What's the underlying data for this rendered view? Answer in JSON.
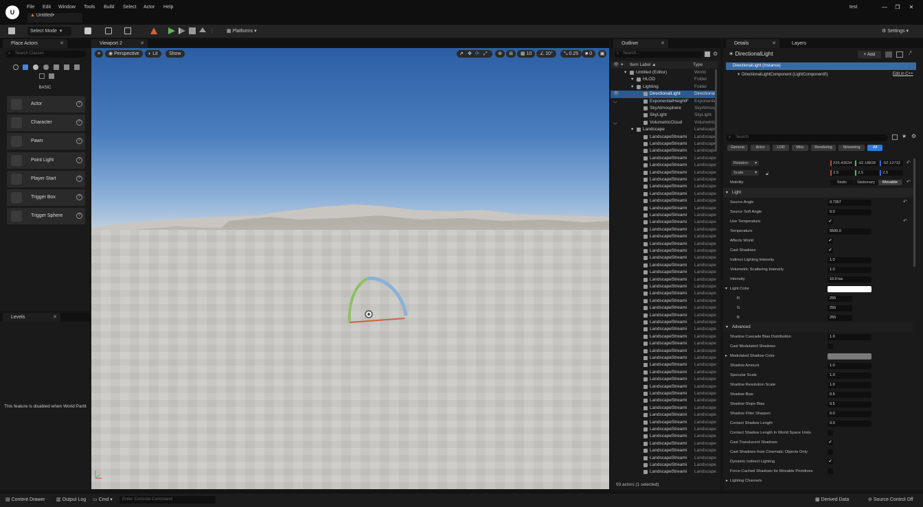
{
  "menu": [
    "File",
    "Edit",
    "Window",
    "Tools",
    "Build",
    "Select",
    "Actor",
    "Help"
  ],
  "app_tab": "Untitled•",
  "project": "test",
  "window_controls": [
    "—",
    "❐",
    "✕"
  ],
  "toolbar": {
    "select_mode": "Select Mode",
    "platforms": "Platforms",
    "settings": "Settings"
  },
  "place_actors": {
    "tab": "Place Actors",
    "search_placeholder": "Search Classes",
    "section": "BASIC",
    "items": [
      "Actor",
      "Character",
      "Pawn",
      "Point Light",
      "Player Start",
      "Trigger Box",
      "Trigger Sphere"
    ]
  },
  "levels": {
    "tab": "Levels",
    "message": "This feature is disabled when World Partit"
  },
  "viewport": {
    "tab": "Viewport 2",
    "perspective": "Perspective",
    "lit": "Lit",
    "show": "Show",
    "grid_snap": "10",
    "rot_snap": "10°",
    "scale_snap": "0.25",
    "cam_speed": "0"
  },
  "outliner": {
    "tab": "Outliner",
    "search_placeholder": "Search...",
    "col_label": "Item Label ▲",
    "col_type": "Type",
    "rows": [
      {
        "label": "Untitled (Editor)",
        "type": "World",
        "indent": 0
      },
      {
        "label": "HLOD",
        "type": "Folder",
        "indent": 1
      },
      {
        "label": "Lighting",
        "type": "Folder",
        "indent": 1
      },
      {
        "label": "DirectionalLight",
        "type": "Directional",
        "indent": 2
      },
      {
        "label": "ExponentialHeightF",
        "type": "Exponentia",
        "indent": 2
      },
      {
        "label": "SkyAtmosphere",
        "type": "SkyAtmosp",
        "indent": 2
      },
      {
        "label": "SkyLight",
        "type": "SkyLight",
        "indent": 2
      },
      {
        "label": "VolumetricCloud",
        "type": "Volumetric",
        "indent": 2
      },
      {
        "label": "Landscape",
        "type": "Landscape",
        "indent": 1
      }
    ],
    "streaming_label": "LandscapeStreami",
    "streaming_type": "Landscape",
    "streaming_count": 48,
    "footer": "93 actors (1 selected)"
  },
  "details": {
    "tab": "Details",
    "tab2": "Layers",
    "title": "DirectionalLight",
    "add": "+ Add",
    "instance": "DirectionalLight (Instance)",
    "component": "DirectionalLightComponent (LightComponent0)",
    "edit_cpp": "Edit in C++",
    "search_placeholder": "Search",
    "filters": [
      "General",
      "Actor",
      "LOD",
      "Misc",
      "Rendering",
      "Streaming",
      "All"
    ],
    "rotation_label": "Rotation",
    "rotation": [
      "225.43634",
      "-92.18828",
      "-92.12732"
    ],
    "scale_label": "Scale",
    "scale": [
      "2.5",
      "2.5",
      "2.5"
    ],
    "mobility_label": "Mobility",
    "mobility": [
      "Static",
      "Stationary",
      "Movable"
    ],
    "cat_light": "Light",
    "cat_advanced": "Advanced",
    "cat_channels": "Lighting Channels",
    "light_rows": [
      {
        "label": "Source Angle",
        "value": "0.7357"
      },
      {
        "label": "Source Soft Angle",
        "value": "0.0"
      },
      {
        "label": "Use Temperature",
        "check": "✔"
      },
      {
        "label": "Temperature",
        "value": "5500.0"
      },
      {
        "label": "Affects World",
        "check": "✔"
      },
      {
        "label": "Cast Shadows",
        "check": "✔"
      },
      {
        "label": "Indirect Lighting Intensity",
        "value": "1.0"
      },
      {
        "label": "Volumetric Scattering Intensity",
        "value": "1.0"
      },
      {
        "label": "Intensity",
        "value": "10.0 lux"
      },
      {
        "label": "Light Color",
        "color": "#ffffff"
      },
      {
        "label": "R",
        "value": "255"
      },
      {
        "label": "G",
        "value": "255"
      },
      {
        "label": "B",
        "value": "255"
      }
    ],
    "advanced_rows": [
      {
        "label": "Shadow Cascade Bias Distribution",
        "value": "1.0"
      },
      {
        "label": "Cast Modulated Shadows",
        "check": ""
      },
      {
        "label": "Modulated Shadow Color",
        "color": "#7a7a7a"
      },
      {
        "label": "Shadow Amount",
        "value": "1.0"
      },
      {
        "label": "Specular Scale",
        "value": "1.0"
      },
      {
        "label": "Shadow Resolution Scale",
        "value": "1.0"
      },
      {
        "label": "Shadow Bias",
        "value": "0.5"
      },
      {
        "label": "Shadow Slope Bias",
        "value": "0.5"
      },
      {
        "label": "Shadow Filter Sharpen",
        "value": "0.0"
      },
      {
        "label": "Contact Shadow Length",
        "value": "0.0"
      },
      {
        "label": "Contact Shadow Length In World Space Units",
        "check": ""
      },
      {
        "label": "Cast Translucent Shadows",
        "check": "✔"
      },
      {
        "label": "Cast Shadows from Cinematic Objects Only",
        "check": ""
      },
      {
        "label": "Dynamic Indirect Lighting",
        "check": "✔"
      },
      {
        "label": "Force Cached Shadows for Movable Primitives",
        "check": ""
      }
    ]
  },
  "statusbar": {
    "content_drawer": "Content Drawer",
    "output_log": "Output Log",
    "cmd": "Cmd",
    "console_placeholder": "Enter Console Command",
    "derived_data": "Derived Data",
    "source_control": "Source Control Off"
  }
}
